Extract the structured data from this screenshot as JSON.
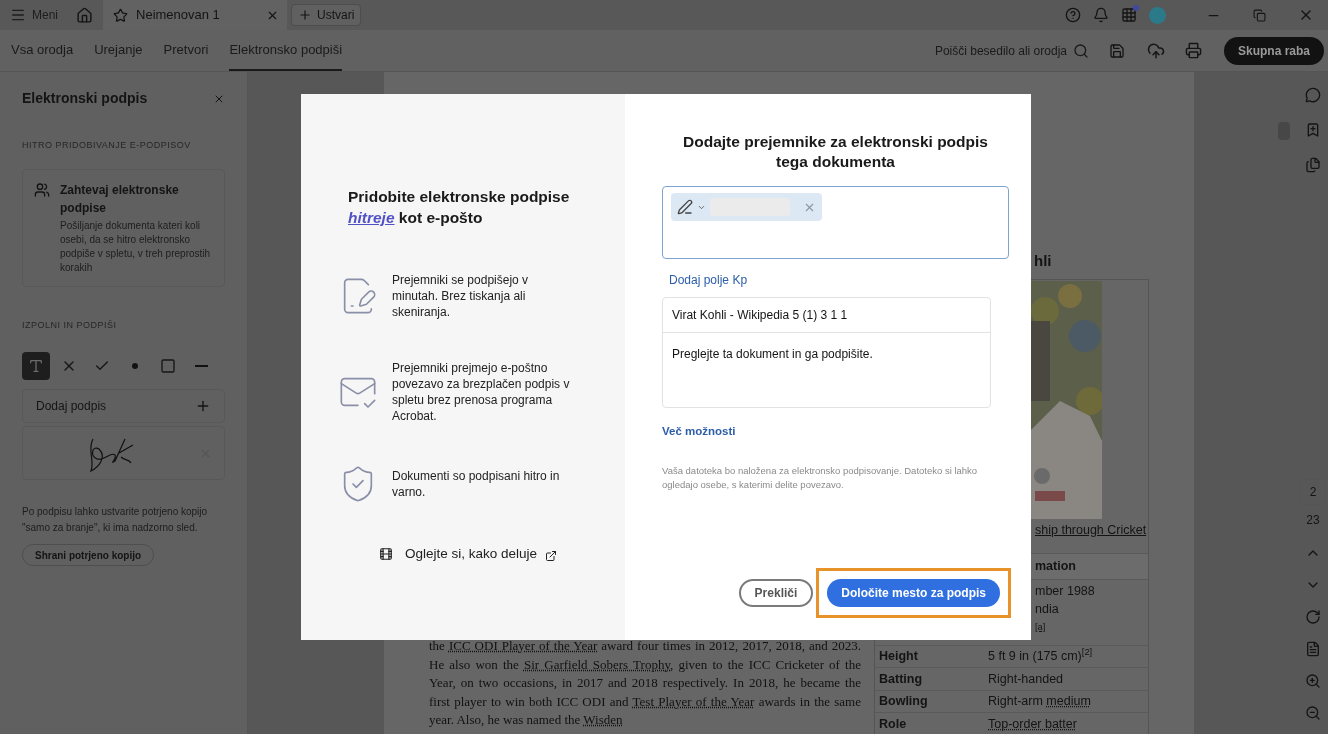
{
  "title_bar": {
    "menu": "Meni",
    "tab": {
      "title": "Neimenovan 1"
    },
    "new_button": "Ustvari"
  },
  "toolbar": {
    "tabs": [
      {
        "label": "Vsa orodja",
        "selected": false
      },
      {
        "label": "Urejanje",
        "selected": false
      },
      {
        "label": "Pretvori",
        "selected": false
      },
      {
        "label": "Elektronsko podpiši",
        "selected": true
      }
    ],
    "search": "Poišči besedilo ali orodja",
    "share_button": "Skupna raba"
  },
  "side_panel": {
    "title": "Elektronski podpis",
    "section_1": "HITRO PRIDOBIVANJE E-PODPISOV",
    "request_card": {
      "title": "Zahtevaj elektronske podpise",
      "description": "Pošiljanje dokumenta kateri koli osebi, da se hitro elektronsko podpiše v spletu, v treh preprostih korakih"
    },
    "section_2": "IZPOLNI IN PODPIŠI",
    "tools": [
      {
        "kind": "text",
        "selected": true
      },
      {
        "kind": "cross",
        "selected": false
      },
      {
        "kind": "check",
        "selected": false
      },
      {
        "kind": "dot",
        "selected": false
      },
      {
        "kind": "rect",
        "selected": false
      },
      {
        "kind": "line",
        "selected": false
      }
    ],
    "add_signature": "Dodaj podpis",
    "note": "Po podpisu lahko ustvarite potrjeno kopijo \"samo za branje\", ki ima nadzorno sled.",
    "save_button": "Shrani potrjeno kopijo"
  },
  "document": {
    "infobox": {
      "title_fragment": "hli",
      "caption_fragment": "ship through Cricket",
      "header_fragment": "mation",
      "partial_lines": [
        "mber 1988",
        "ndia"
      ],
      "partial_ref": "[a]",
      "rows": [
        {
          "label": "Height",
          "value": [
            {
              "kind": "text",
              "text": "5 ft 9 in (175 cm)"
            },
            {
              "kind": "ref",
              "text": "[2]"
            }
          ]
        },
        {
          "label": "Batting",
          "value": [
            {
              "kind": "text",
              "text": "Right-handed"
            }
          ]
        },
        {
          "label": "Bowling",
          "value": [
            {
              "kind": "text",
              "text": "Right-arm "
            },
            {
              "kind": "link",
              "text": "medium"
            }
          ]
        },
        {
          "label": "Role",
          "value": [
            {
              "kind": "link",
              "text": "Top-order batter"
            }
          ]
        }
      ]
    },
    "paragraph": [
      {
        "kind": "text",
        "text": "the "
      },
      {
        "kind": "link",
        "text": "ICC ODI Player of the Year"
      },
      {
        "kind": "text",
        "text": " award four times in 2012, 2017, 2018, and 2023. He also won the "
      },
      {
        "kind": "link",
        "text": "Sir Garfield Sobers Trophy"
      },
      {
        "kind": "text",
        "text": ", given to the ICC Cricketer of the Year, on two occasions, in 2017 and 2018 respectively. In 2018, he became the first player to win both ICC ODI and "
      },
      {
        "kind": "link",
        "text": "Test Player of the Year"
      },
      {
        "kind": "text",
        "text": " awards in the same year. Also, he was named the "
      },
      {
        "kind": "link",
        "text": "Wisden"
      }
    ]
  },
  "page_rail": {
    "page_number": "2",
    "page_count": "23"
  },
  "dialog": {
    "left": {
      "heading": "Pridobite elektronske podpise",
      "heading_link": "hitreje",
      "heading_end": "kot e-pošto",
      "features": [
        "Prejemniki se podpišejo v minutah. Brez tiskanja ali skeniranja.",
        "Prejemniki prejmejo e-poštno povezavo za brezplačen podpis v spletu brez prenosa programa Acrobat.",
        "Dokumenti so podpisani hitro in varno."
      ],
      "video_link": "Oglejte si, kako deluje"
    },
    "right": {
      "heading": "Dodajte prejemnike za elektronski podpis tega dokumenta",
      "add_cc": "Dodaj polje Kp",
      "subject": "Virat Kohli - Wikipedia 5 (1) 3 1 1",
      "message": "Preglejte ta dokument in ga podpišite.",
      "more_options": "Več možnosti",
      "note": "Vaša datoteka bo naložena za elektronsko podpisovanje. Datoteko si lahko ogledajo osebe, s katerimi delite povezavo.",
      "cancel_button": "Prekliči",
      "primary_button": {
        "label": "Določite mesto za podpis",
        "highlighted": true
      }
    }
  }
}
